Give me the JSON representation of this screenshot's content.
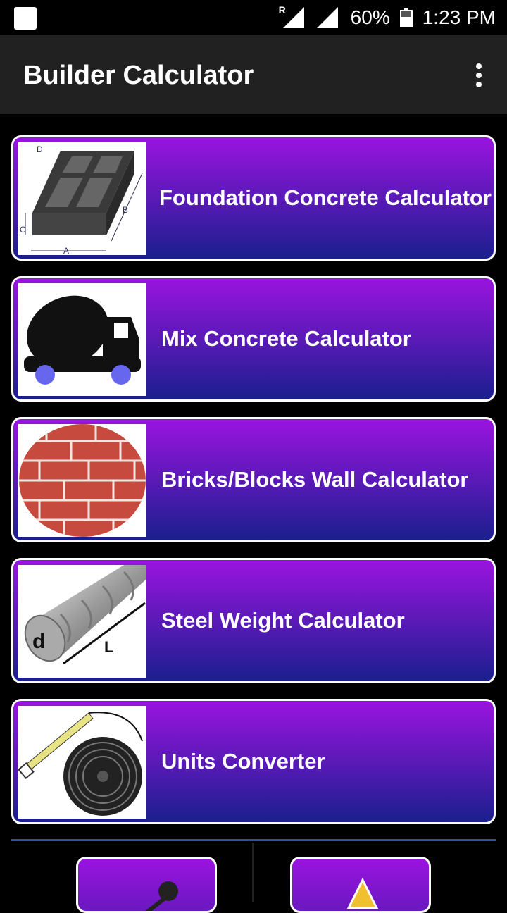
{
  "status": {
    "battery_pct": "60%",
    "time": "1:23 PM",
    "roaming_indicator": "R"
  },
  "appbar": {
    "title": "Builder Calculator",
    "menu_icon": "more-vert-icon"
  },
  "cards": [
    {
      "label": "Foundation Concrete Calculator",
      "icon": "foundation-icon"
    },
    {
      "label": "Mix Concrete Calculator",
      "icon": "concrete-mixer-truck-icon"
    },
    {
      "label": "Bricks/Blocks Wall Calculator",
      "icon": "brick-wall-icon"
    },
    {
      "label": "Steel Weight Calculator",
      "icon": "steel-rebar-icon"
    },
    {
      "label": "Units Converter",
      "icon": "measuring-tape-icon"
    }
  ],
  "foundation_dims": {
    "a": "A",
    "b": "B",
    "c": "C",
    "d": "D"
  },
  "steel_dims": {
    "d": "d",
    "l": "L"
  },
  "bottom_buttons": [
    {
      "icon": "share-icon"
    },
    {
      "icon": "warning-icon"
    }
  ],
  "colors": {
    "card_top": "#9a14e0",
    "card_bottom": "#1a1f8e",
    "appbar": "#212121"
  }
}
